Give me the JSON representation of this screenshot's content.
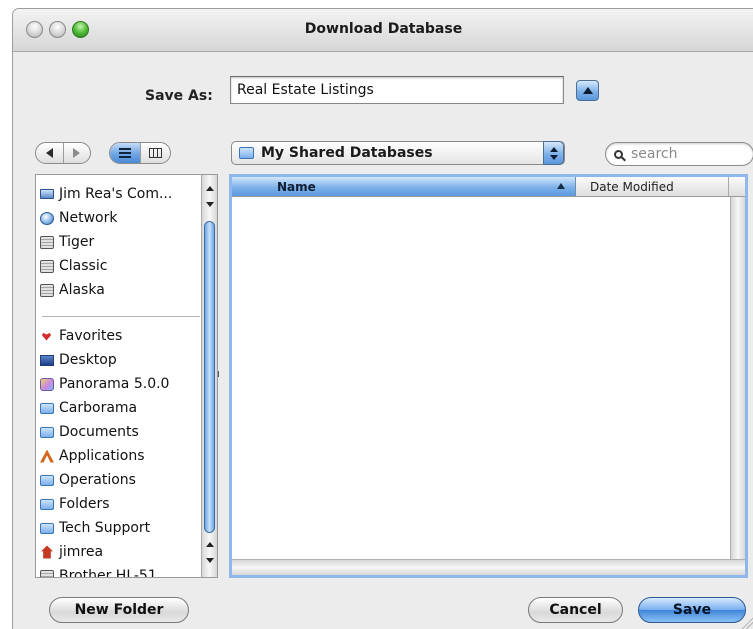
{
  "window": {
    "title": "Download Database"
  },
  "save_as": {
    "label": "Save As:",
    "value": "Real Estate Listings"
  },
  "toolbar": {
    "location": "My Shared Databases",
    "search_placeholder": "search"
  },
  "sidebar": {
    "devices": [
      {
        "label": "Jim Rea's Com...",
        "icon": "computer-icon"
      },
      {
        "label": "Network",
        "icon": "network-icon"
      },
      {
        "label": "Tiger",
        "icon": "disk-icon"
      },
      {
        "label": "Classic",
        "icon": "disk-icon"
      },
      {
        "label": "Alaska",
        "icon": "disk-icon"
      }
    ],
    "places": [
      {
        "label": "Favorites",
        "icon": "heart-icon"
      },
      {
        "label": "Desktop",
        "icon": "desktop-icon"
      },
      {
        "label": "Panorama 5.0.0",
        "icon": "app-icon"
      },
      {
        "label": "Carborama",
        "icon": "folder-icon"
      },
      {
        "label": "Documents",
        "icon": "folder-icon"
      },
      {
        "label": "Applications",
        "icon": "applications-icon"
      },
      {
        "label": "Operations",
        "icon": "folder-icon"
      },
      {
        "label": "Folders",
        "icon": "folder-icon"
      },
      {
        "label": "Tech Support",
        "icon": "folder-icon"
      },
      {
        "label": "jimrea",
        "icon": "home-icon"
      },
      {
        "label": "Brother HL-51",
        "icon": "printer-icon"
      }
    ]
  },
  "browser": {
    "columns": [
      "Name",
      "Date Modified"
    ],
    "sorted_column": "Name"
  },
  "buttons": {
    "new_folder": "New Folder",
    "cancel": "Cancel",
    "save": "Save"
  },
  "colors": {
    "accent_blue": "#7cb1ea",
    "window_bg": "#ececec",
    "zoom_green": "#59c23f"
  }
}
